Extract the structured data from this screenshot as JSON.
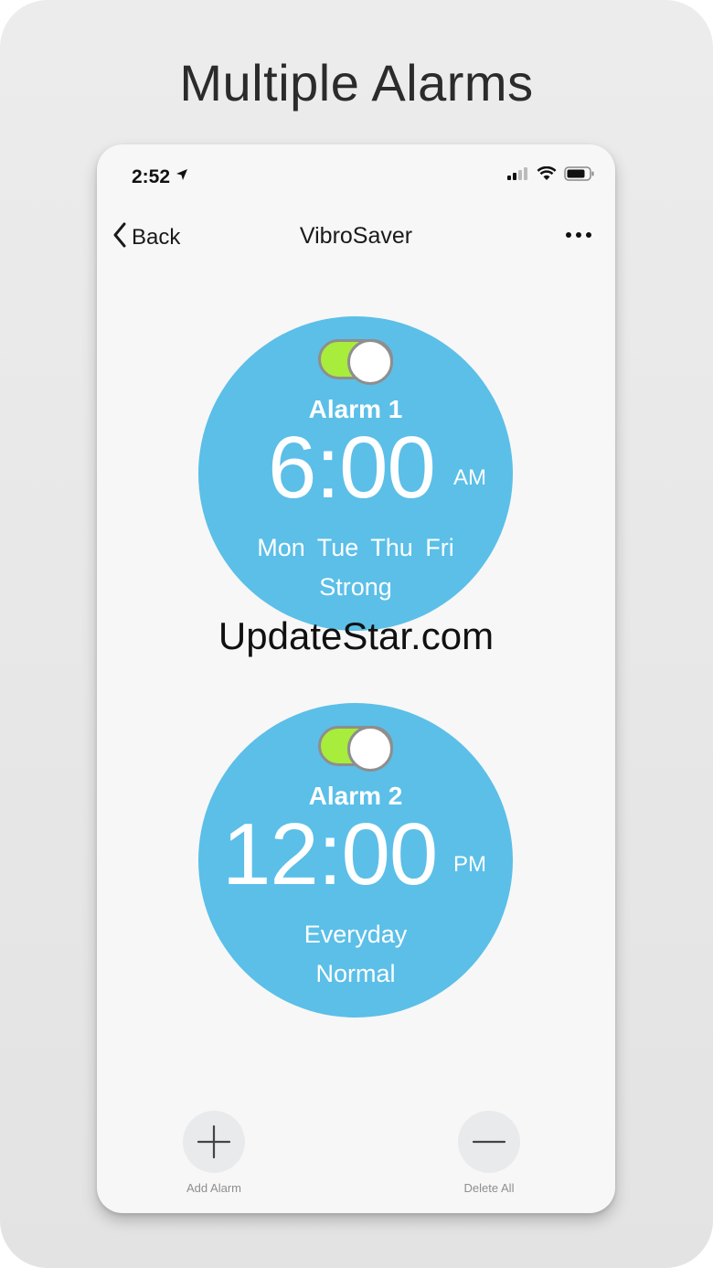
{
  "headline": "Multiple Alarms",
  "status_bar": {
    "time": "2:52"
  },
  "nav": {
    "back_label": "Back",
    "title": "VibroSaver"
  },
  "alarms": [
    {
      "name": "Alarm 1",
      "time": "6:00",
      "period": "AM",
      "days": "Mon Tue Thu Fri",
      "intensity": "Strong",
      "enabled": true
    },
    {
      "name": "Alarm 2",
      "time": "12:00",
      "period": "PM",
      "days": "Everyday",
      "intensity": "Normal",
      "enabled": true
    }
  ],
  "watermark": "UpdateStar.com",
  "actions": {
    "add_label": "Add Alarm",
    "delete_label": "Delete All"
  },
  "colors": {
    "circle": "#5bbfe8",
    "toggle_on": "#a8ec3c",
    "background": "#f7f7f7"
  },
  "icons": [
    "location-arrow-icon",
    "signal-icon",
    "wifi-icon",
    "battery-icon",
    "chevron-left-icon",
    "more-icon",
    "plus-icon",
    "minus-icon"
  ]
}
